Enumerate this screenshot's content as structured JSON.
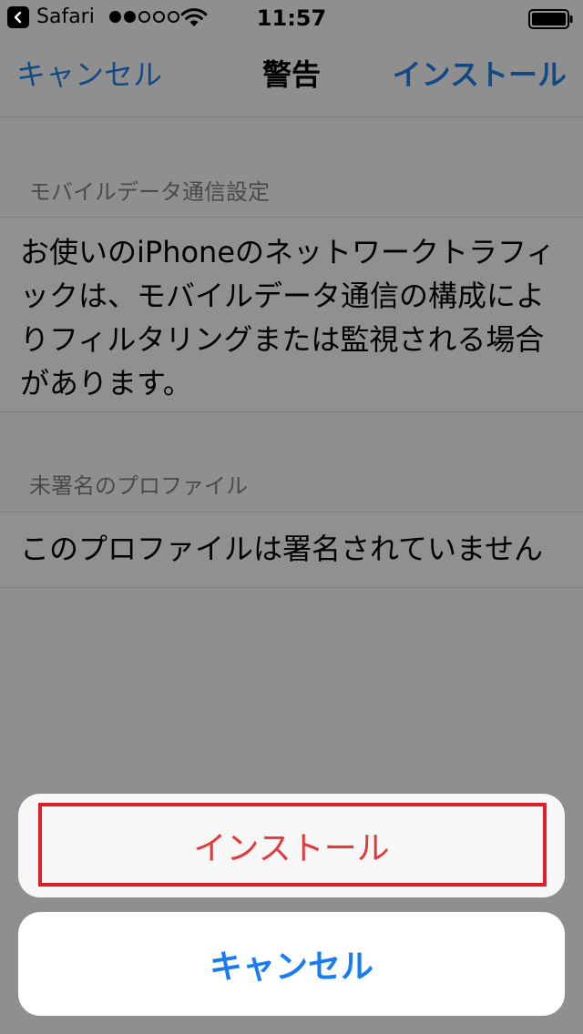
{
  "status_bar": {
    "back_app": "Safari",
    "signal_strength": 2,
    "signal_max": 5,
    "time": "11:57",
    "icons": [
      "back-chevron-icon",
      "signal-dots-icon",
      "wifi-icon",
      "battery-icon"
    ]
  },
  "nav": {
    "cancel_label": "キャンセル",
    "title": "警告",
    "install_label": "インストール"
  },
  "sections": [
    {
      "header": "モバイルデータ通信設定",
      "body": "お使いのiPhoneのネットワークトラフィックは、モバイルデータ通信の構成によりフィルタリングまたは監視される場合があります。"
    },
    {
      "header": "未署名のプロファイル",
      "body": "このプロファイルは署名されていません"
    }
  ],
  "action_sheet": {
    "install_label": "インストール",
    "cancel_label": "キャンセル"
  },
  "colors": {
    "dimmed_background": "#8f8f8f",
    "nav_link": "#134a84",
    "destructive_red": "#e5383b",
    "action_blue": "#1a7cf5",
    "highlight_box": "#e41e26",
    "sheet_background": "#f7f7f7"
  }
}
